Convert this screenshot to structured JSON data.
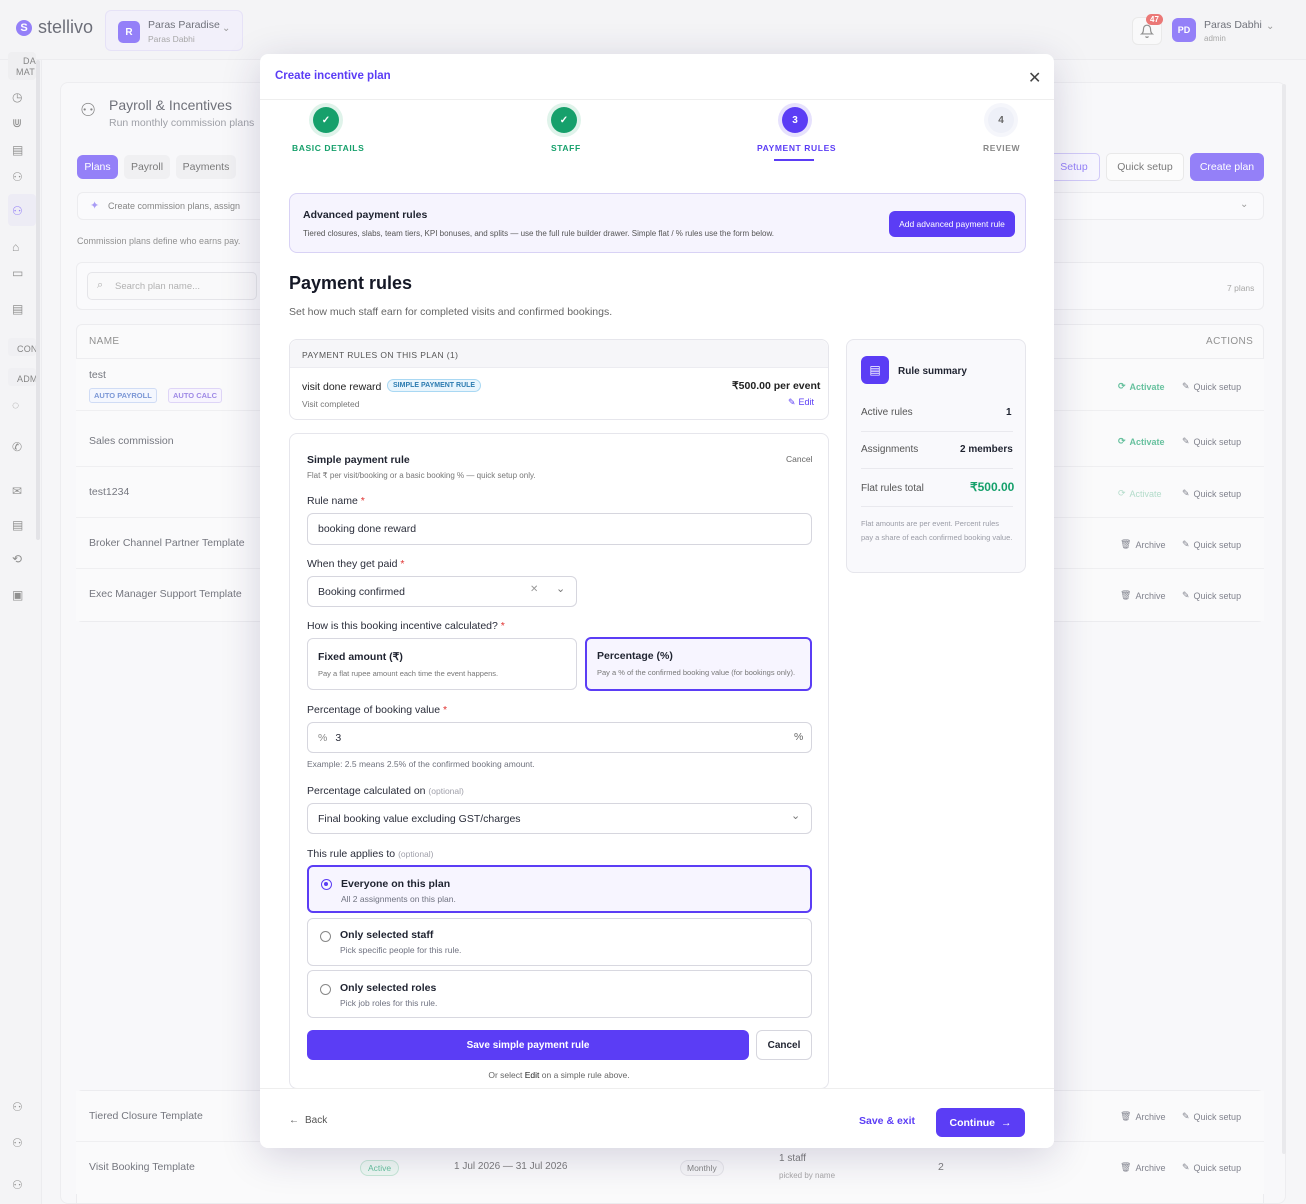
{
  "app": {
    "name": "stellivo"
  },
  "workspace": {
    "initial": "R",
    "name": "Paras Paradise",
    "owner": "Paras Dabhi"
  },
  "header": {
    "notif_count": "47",
    "user_initials": "PD",
    "user_name": "Paras Dabhi",
    "user_role": "admin"
  },
  "sidebar": {
    "top_label_1": "DA",
    "top_label_2": "MAT",
    "section_con": "CON",
    "section_adm": "ADM"
  },
  "page": {
    "title": "Payroll & Incentives",
    "subtitle": "Run monthly commission plans",
    "tabs": [
      "Plans",
      "Payroll",
      "Payments"
    ],
    "setup_label": "Setup",
    "quick_setup_label": "Quick setup",
    "create_plan_label": "Create plan",
    "info_text": "Create commission plans, assign",
    "desc": "Commission plans define who earns pay.",
    "search_placeholder": "Search plan name...",
    "plans_count": "7 plans",
    "col_name": "NAME",
    "col_actions": "ACTIONS",
    "rows": [
      {
        "name": "test",
        "tag1": "AUTO PAYROLL",
        "tag2": "AUTO CALC",
        "action1": "Activate",
        "action2": "Quick setup"
      },
      {
        "name": "Sales commission",
        "action1": "Activate",
        "action2": "Quick setup"
      },
      {
        "name": "test1234",
        "action1": "Activate",
        "action2": "Quick setup"
      },
      {
        "name": "Broker Channel Partner Template",
        "action1": "Archive",
        "action2": "Quick setup"
      },
      {
        "name": "Exec Manager Support Template",
        "action1": "Archive",
        "action2": "Quick setup"
      },
      {
        "name": "Tiered Closure Template",
        "action1": "Archive",
        "action2": "Quick setup"
      },
      {
        "name": "Visit Booking Template",
        "status": "Active",
        "dates": "1 Jul 2026 — 31 Jul 2026",
        "freq": "Monthly",
        "staff": "1 staff",
        "staff_sub": "picked by name",
        "count": "2",
        "action1": "Archive",
        "action2": "Quick setup"
      }
    ]
  },
  "modal": {
    "title": "Create incentive plan",
    "steps": [
      {
        "num": "✓",
        "label": "BASIC DETAILS",
        "state": "done"
      },
      {
        "num": "✓",
        "label": "STAFF",
        "state": "done"
      },
      {
        "num": "3",
        "label": "PAYMENT RULES",
        "state": "active"
      },
      {
        "num": "4",
        "label": "REVIEW",
        "state": "pending"
      }
    ],
    "advanced": {
      "title": "Advanced payment rules",
      "desc": "Tiered closures, slabs, team tiers, KPI bonuses, and splits — use the full rule builder drawer. Simple flat / % rules use the form below.",
      "button": "Add advanced payment rule"
    },
    "heading": "Payment rules",
    "subheading": "Set how much staff earn for completed visits and confirmed bookings.",
    "rules_header": "PAYMENT RULES ON THIS PLAN (1)",
    "rule": {
      "name": "visit done reward",
      "tag": "SIMPLE PAYMENT RULE",
      "trigger": "Visit completed",
      "amount": "₹500.00 per event",
      "edit": "Edit"
    },
    "form": {
      "title": "Simple payment rule",
      "cancel_link": "Cancel",
      "desc": "Flat ₹ per visit/booking or a basic booking % — quick setup only.",
      "rule_name_label": "Rule name",
      "rule_name_value": "booking done reward",
      "when_label": "When they get paid",
      "when_value": "Booking confirmed",
      "how_label": "How is this booking incentive calculated?",
      "fixed_title": "Fixed amount (₹)",
      "fixed_desc": "Pay a flat rupee amount each time the event happens.",
      "pct_title": "Percentage (%)",
      "pct_desc": "Pay a % of the confirmed booking value (for bookings only).",
      "pct_label": "Percentage of booking value",
      "pct_prefix": "%",
      "pct_value": "3",
      "pct_suffix": "%",
      "pct_hint": "Example: 2.5 means 2.5% of the confirmed booking amount.",
      "calc_label": "Percentage calculated on",
      "optional": "(optional)",
      "calc_value": "Final booking value excluding GST/charges",
      "applies_label": "This rule applies to",
      "options": [
        {
          "title": "Everyone on this plan",
          "desc": "All 2 assignments on this plan."
        },
        {
          "title": "Only selected staff",
          "desc": "Pick specific people for this rule."
        },
        {
          "title": "Only selected roles",
          "desc": "Pick job roles for this rule."
        }
      ],
      "save_button": "Save simple payment rule",
      "cancel_button": "Cancel",
      "note_pre": "Or select",
      "note_edit": "Edit",
      "note_post": "on a simple rule above."
    },
    "summary": {
      "title": "Rule summary",
      "active_label": "Active rules",
      "active_value": "1",
      "assign_label": "Assignments",
      "assign_value": "2 members",
      "flat_label": "Flat rules total",
      "flat_value": "₹500.00",
      "note": "Flat amounts are per event. Percent rules pay a share of each confirmed booking value."
    },
    "footer": {
      "back": "Back",
      "save_exit": "Save & exit",
      "continue": "Continue"
    }
  },
  "colors": {
    "accent": "#5b3df5",
    "success": "#16a06b",
    "danger": "#e0312f"
  }
}
